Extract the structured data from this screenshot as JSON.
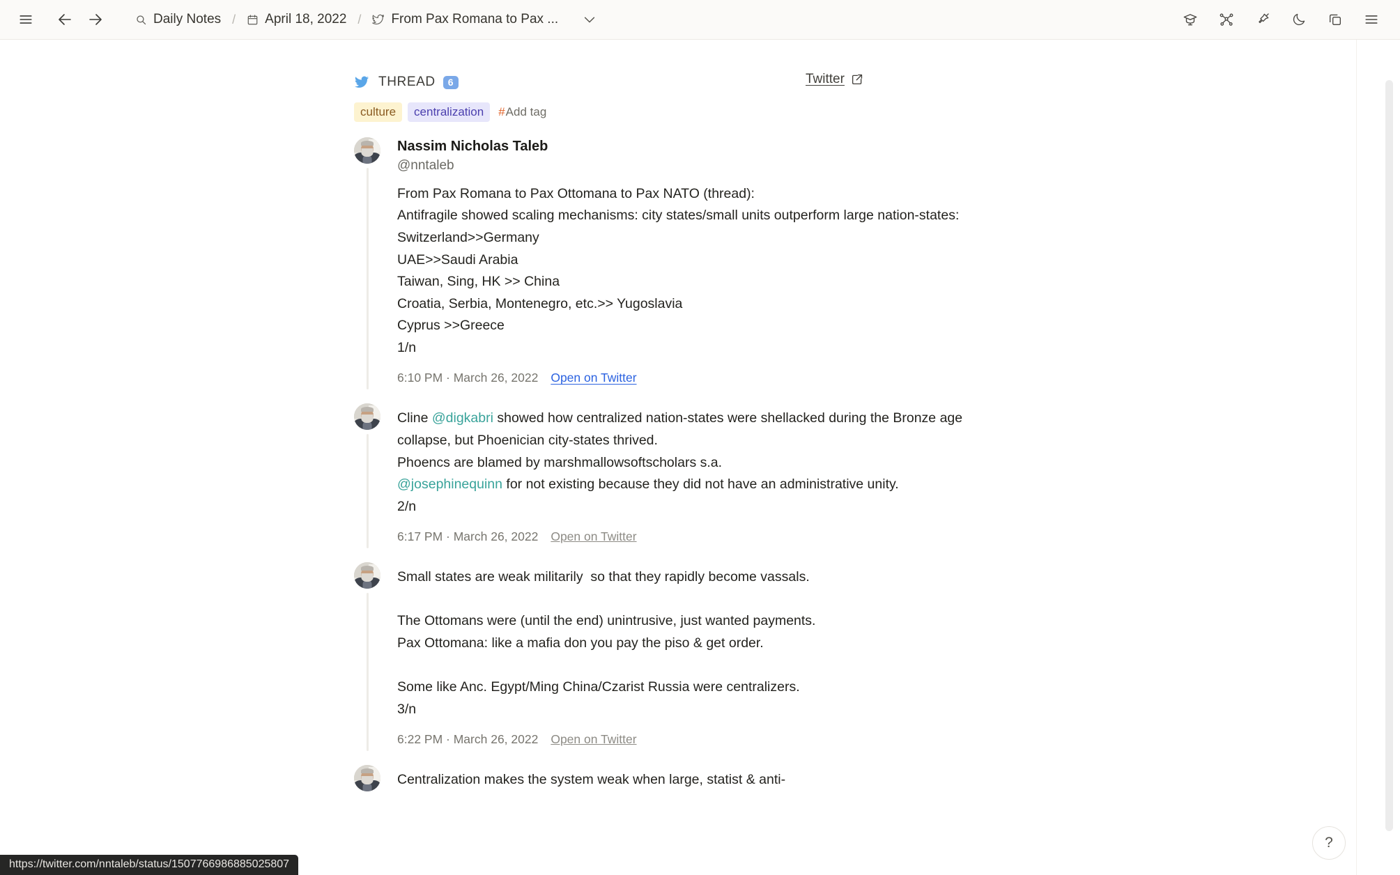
{
  "topbar": {
    "menu_icon": "hamburger-menu-icon",
    "back_icon": "arrow-left-icon",
    "forward_icon": "arrow-right-icon",
    "breadcrumb": [
      {
        "icon": "search-icon",
        "label": "Daily Notes"
      },
      {
        "icon": "calendar-icon",
        "label": "April 18, 2022"
      },
      {
        "icon": "twitter-bird-icon",
        "label": "From Pax Romana to Pax ..."
      }
    ],
    "separator": "/",
    "chevron_icon": "chevron-down-icon",
    "right_icons": [
      "graduation-cap-icon",
      "graph-network-icon",
      "pin-icon",
      "moon-dark-mode-icon",
      "duplicate-window-icon",
      "hamburger-menu-icon"
    ]
  },
  "thread": {
    "bird_icon": "twitter-bird-icon",
    "label": "THREAD",
    "count": "6",
    "external_link_label": "Twitter",
    "external_link_icon": "external-link-icon",
    "tags": [
      {
        "label": "culture",
        "bg": "#fdf3d0",
        "fg": "#8a5b21"
      },
      {
        "label": "centralization",
        "bg": "#e7e6fb",
        "fg": "#4b3fae"
      }
    ],
    "add_tag_hash": "#",
    "add_tag_label": "Add tag"
  },
  "author": {
    "name": "Nassim Nicholas Taleb",
    "handle": "@nntaleb"
  },
  "tweets": [
    {
      "show_author": true,
      "segments": [
        {
          "type": "text",
          "value": "From Pax Romana to Pax Ottomana to Pax NATO (thread):\nAntifragile showed scaling mechanisms: city states/small units outperform large nation-states:\nSwitzerland>>Germany\nUAE>>Saudi Arabia\nTaiwan, Sing, HK >> China\nCroatia, Serbia, Montenegro, etc.>> Yugoslavia\nCyprus >>Greece\n1/n"
        }
      ],
      "time": "6:10 PM · March 26, 2022",
      "open_label": "Open on Twitter",
      "open_active": true
    },
    {
      "show_author": false,
      "segments": [
        {
          "type": "text",
          "value": "Cline "
        },
        {
          "type": "mention",
          "value": "@digkabri"
        },
        {
          "type": "text",
          "value": " showed how centralized nation-states were shellacked during the Bronze age collapse, but Phoenician city-states thrived.\nPhoencs are blamed by marshmallowsoftscholars s.a.\n"
        },
        {
          "type": "mention",
          "value": "@josephinequinn"
        },
        {
          "type": "text",
          "value": " for not existing because they did not have an administrative unity.\n2/n"
        }
      ],
      "time": "6:17 PM · March 26, 2022",
      "open_label": "Open on Twitter",
      "open_active": false
    },
    {
      "show_author": false,
      "segments": [
        {
          "type": "text",
          "value": "Small states are weak militarily  so that they rapidly become vassals.\n\nThe Ottomans were (until the end) unintrusive, just wanted payments.\nPax Ottomana: like a mafia don you pay the piso & get order.\n\nSome like Anc. Egypt/Ming China/Czarist Russia were centralizers.\n3/n"
        }
      ],
      "time": "6:22 PM · March 26, 2022",
      "open_label": "Open on Twitter",
      "open_active": false
    },
    {
      "show_author": false,
      "segments": [
        {
          "type": "text",
          "value": "Centralization makes the system weak when large, statist & anti-"
        }
      ],
      "time": "",
      "open_label": "",
      "open_active": false
    }
  ],
  "help_button": {
    "label": "?"
  },
  "statusbar": {
    "url": "https://twitter.com/nntaleb/status/1507766986885025807"
  }
}
